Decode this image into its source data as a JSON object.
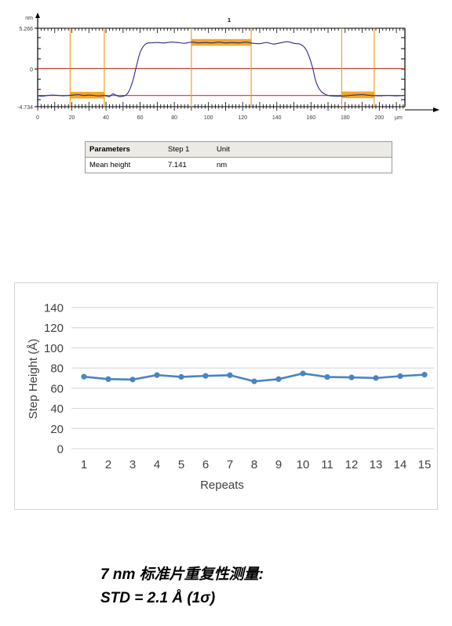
{
  "profile": {
    "y_axis_unit": "nm",
    "y_max_label": "5.266",
    "y_zero_label": "0",
    "y_min_label": "-4.734",
    "series_label": "1",
    "x_unit": "µm",
    "x_ticks": [
      "0",
      "20",
      "40",
      "60",
      "80",
      "100",
      "120",
      "140",
      "160",
      "180",
      "200"
    ],
    "colors": {
      "trace": "#2b2b8f",
      "cursor": "#f0a020",
      "level_line": "#c0392b",
      "fill": "#f5a623",
      "axis": "#000000"
    },
    "chart_data": {
      "type": "line",
      "title": "",
      "xlabel": "µm",
      "ylabel": "nm",
      "xlim": [
        0,
        215
      ],
      "ylim": [
        -4.734,
        5.266
      ],
      "grid": false,
      "legend": "none",
      "cursor_regions_um": [
        [
          19,
          39
        ],
        [
          90,
          125
        ],
        [
          178,
          197
        ]
      ],
      "level_lines_nm": [
        0.12,
        -3.3
      ],
      "x": [
        0,
        3,
        6,
        9,
        12,
        15,
        18,
        21,
        24,
        27,
        30,
        33,
        36,
        39,
        42,
        44,
        46,
        48,
        50,
        52,
        54,
        56,
        58,
        60,
        62,
        64,
        66,
        70,
        74,
        78,
        82,
        86,
        90,
        94,
        98,
        102,
        106,
        110,
        114,
        118,
        122,
        126,
        130,
        134,
        138,
        142,
        146,
        150,
        154,
        157,
        159,
        161,
        163,
        166,
        170,
        175,
        180,
        185,
        190,
        195,
        200,
        205,
        210,
        215
      ],
      "y": [
        -3.35,
        -3.4,
        -3.3,
        -3.25,
        -3.3,
        -3.35,
        -3.3,
        -3.25,
        -3.2,
        -3.3,
        -3.25,
        -3.3,
        -3.35,
        -3.3,
        -3.45,
        -3.1,
        -3.3,
        -3.45,
        -3.4,
        -3.2,
        -2.5,
        -1.2,
        0.6,
        2.2,
        3.0,
        3.35,
        3.4,
        3.45,
        3.4,
        3.5,
        3.45,
        3.35,
        3.5,
        3.4,
        3.45,
        3.4,
        3.5,
        3.4,
        3.45,
        3.4,
        3.5,
        3.35,
        3.3,
        3.45,
        3.25,
        3.4,
        3.55,
        3.35,
        3.2,
        2.6,
        1.6,
        0.2,
        -1.6,
        -2.8,
        -3.3,
        -3.4,
        -3.35,
        -3.25,
        -3.2,
        -3.3,
        -3.35,
        -3.3,
        -3.35,
        -3.3
      ]
    }
  },
  "params_table": {
    "headers": [
      "Parameters",
      "Step 1",
      "Unit",
      ""
    ],
    "rows": [
      {
        "name": "Mean height",
        "value": "7.141",
        "unit": "nm",
        "extra": ""
      }
    ]
  },
  "repeat_chart": {
    "chart_data": {
      "type": "line",
      "title": "",
      "xlabel": "Repeats",
      "ylabel": "Step Height (Å)",
      "categories": [
        "1",
        "2",
        "3",
        "4",
        "5",
        "6",
        "7",
        "8",
        "9",
        "10",
        "11",
        "12",
        "13",
        "14",
        "15"
      ],
      "values": [
        71.4,
        69.0,
        68.6,
        73.0,
        71.2,
        72.2,
        72.9,
        66.8,
        69.0,
        74.6,
        71.1,
        70.7,
        70.1,
        72.0,
        73.4
      ],
      "ylim": [
        0,
        140
      ],
      "yticks": [
        0,
        20,
        40,
        60,
        80,
        100,
        120,
        140
      ],
      "grid": true,
      "legend": "none",
      "series_color": "#4a83c4",
      "gridline_color": "#d9d9d9"
    }
  },
  "caption": {
    "line1": "7 nm 标准片重复性测量:",
    "line2": "STD = 2.1 Å (1σ)"
  }
}
